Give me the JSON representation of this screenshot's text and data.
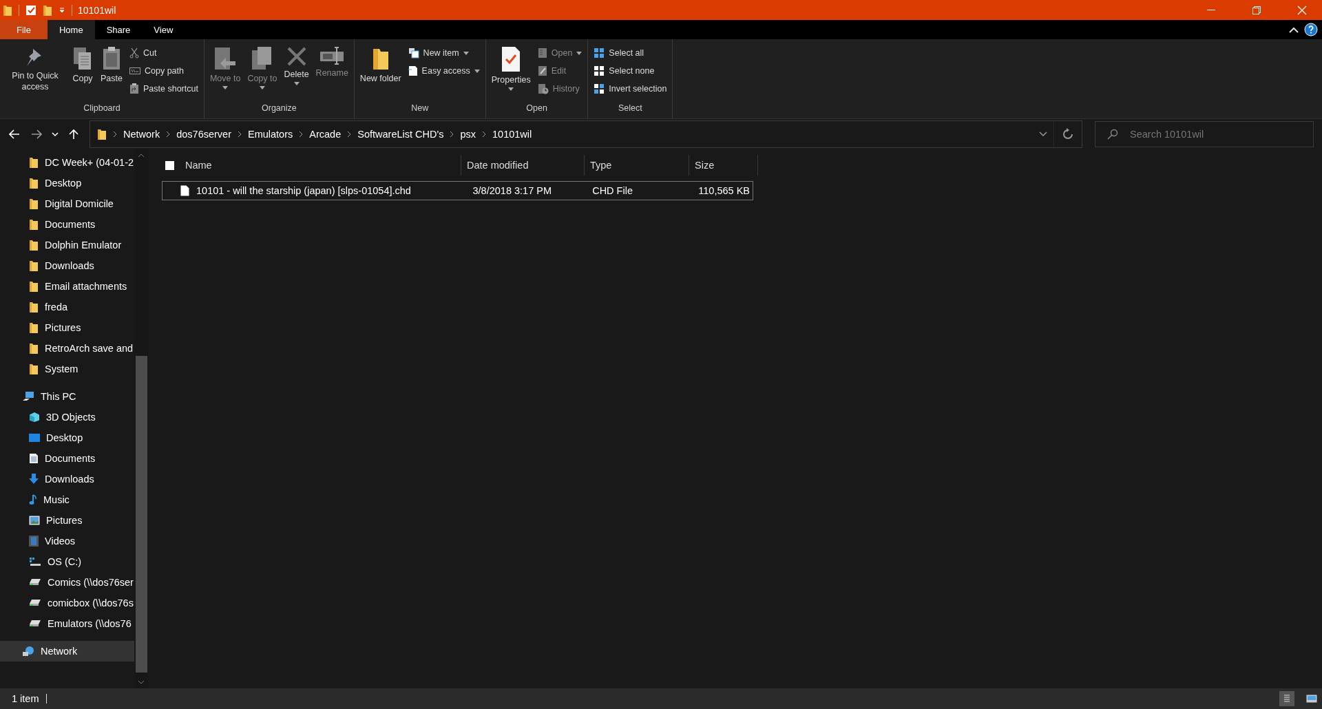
{
  "window": {
    "title": "10101wil"
  },
  "ribbon_tabs": [
    {
      "label": "File",
      "kind": "file",
      "selected": false
    },
    {
      "label": "Home",
      "kind": "tab",
      "selected": true
    },
    {
      "label": "Share",
      "kind": "tab",
      "selected": false
    },
    {
      "label": "View",
      "kind": "tab",
      "selected": false
    }
  ],
  "ribbon_groups": [
    {
      "label": "Clipboard",
      "items": [
        {
          "kind": "large",
          "label": "Pin to Quick access",
          "disabled": false,
          "has_menu": false
        },
        {
          "kind": "large",
          "label": "Copy",
          "disabled": false,
          "has_menu": false
        },
        {
          "kind": "large",
          "label": "Paste",
          "disabled": false,
          "has_menu": false
        },
        {
          "kind": "small",
          "label": "Cut",
          "disabled": false,
          "has_menu": false
        },
        {
          "kind": "small",
          "label": "Copy path",
          "disabled": false,
          "has_menu": false
        },
        {
          "kind": "small",
          "label": "Paste shortcut",
          "disabled": false,
          "has_menu": false
        }
      ]
    },
    {
      "label": "Organize",
      "items": [
        {
          "kind": "large",
          "label": "Move to",
          "disabled": true,
          "has_menu": true
        },
        {
          "kind": "large",
          "label": "Copy to",
          "disabled": true,
          "has_menu": true
        },
        {
          "kind": "large",
          "label": "Delete",
          "disabled": false,
          "has_menu": true
        },
        {
          "kind": "large",
          "label": "Rename",
          "disabled": true,
          "has_menu": false
        }
      ]
    },
    {
      "label": "New",
      "items": [
        {
          "kind": "large",
          "label": "New folder",
          "disabled": false,
          "has_menu": false
        },
        {
          "kind": "small",
          "label": "New item",
          "disabled": false,
          "has_menu": true
        },
        {
          "kind": "small",
          "label": "Easy access",
          "disabled": false,
          "has_menu": true
        }
      ]
    },
    {
      "label": "Open",
      "items": [
        {
          "kind": "large",
          "label": "Properties",
          "disabled": false,
          "has_menu": true
        },
        {
          "kind": "small",
          "label": "Open",
          "disabled": true,
          "has_menu": true
        },
        {
          "kind": "small",
          "label": "Edit",
          "disabled": true,
          "has_menu": false
        },
        {
          "kind": "small",
          "label": "History",
          "disabled": true,
          "has_menu": false
        }
      ]
    },
    {
      "label": "Select",
      "items": [
        {
          "kind": "small",
          "label": "Select all",
          "disabled": false,
          "has_menu": false
        },
        {
          "kind": "small",
          "label": "Select none",
          "disabled": false,
          "has_menu": false
        },
        {
          "kind": "small",
          "label": "Invert selection",
          "disabled": false,
          "has_menu": false
        }
      ]
    }
  ],
  "address_bar": {
    "breadcrumbs": [
      "Network",
      "dos76server",
      "Emulators",
      "Arcade",
      "SoftwareList CHD's",
      "psx",
      "10101wil"
    ]
  },
  "search": {
    "placeholder": "Search 10101wil"
  },
  "navigation": {
    "quick_access": [
      {
        "label": "DC Week+ (04-01-2",
        "selected": false
      },
      {
        "label": "Desktop",
        "selected": false
      },
      {
        "label": "Digital Domicile",
        "selected": false
      },
      {
        "label": "Documents",
        "selected": false
      },
      {
        "label": "Dolphin Emulator",
        "selected": false
      },
      {
        "label": "Downloads",
        "selected": false
      },
      {
        "label": "Email attachments",
        "selected": false
      },
      {
        "label": "freda",
        "selected": false
      },
      {
        "label": "Pictures",
        "selected": false
      },
      {
        "label": "RetroArch save and",
        "selected": false
      },
      {
        "label": "System",
        "selected": false
      }
    ],
    "this_pc": {
      "label": "This PC",
      "selected": false,
      "children": [
        {
          "label": "3D Objects",
          "kind": "objects",
          "selected": false
        },
        {
          "label": "Desktop",
          "kind": "desktop",
          "selected": false
        },
        {
          "label": "Documents",
          "kind": "documents",
          "selected": false
        },
        {
          "label": "Downloads",
          "kind": "downloads",
          "selected": false
        },
        {
          "label": "Music",
          "kind": "music",
          "selected": false
        },
        {
          "label": "Pictures",
          "kind": "pictures",
          "selected": false
        },
        {
          "label": "Videos",
          "kind": "videos",
          "selected": false
        },
        {
          "label": "OS (C:)",
          "kind": "drive",
          "selected": false
        },
        {
          "label": "Comics (\\\\dos76ser",
          "kind": "netdrive",
          "selected": false
        },
        {
          "label": "comicbox (\\\\dos76s",
          "kind": "netdrive",
          "selected": false
        },
        {
          "label": "Emulators (\\\\dos76",
          "kind": "netdrive",
          "selected": false
        }
      ]
    },
    "network": {
      "label": "Network",
      "selected": true
    }
  },
  "table": {
    "select_all_checked": false,
    "columns": [
      "Name",
      "Date modified",
      "Type",
      "Size"
    ],
    "rows": [
      {
        "name": "10101 - will the starship (japan) [slps-01054].chd",
        "date_modified": "3/8/2018 3:17 PM",
        "type": "CHD File",
        "size": "110,565 KB",
        "selected": false,
        "focused": true
      }
    ]
  },
  "status_bar": {
    "text": "1 item",
    "views": [
      {
        "kind": "details",
        "selected": true
      },
      {
        "kind": "large_icons",
        "selected": false
      }
    ]
  }
}
